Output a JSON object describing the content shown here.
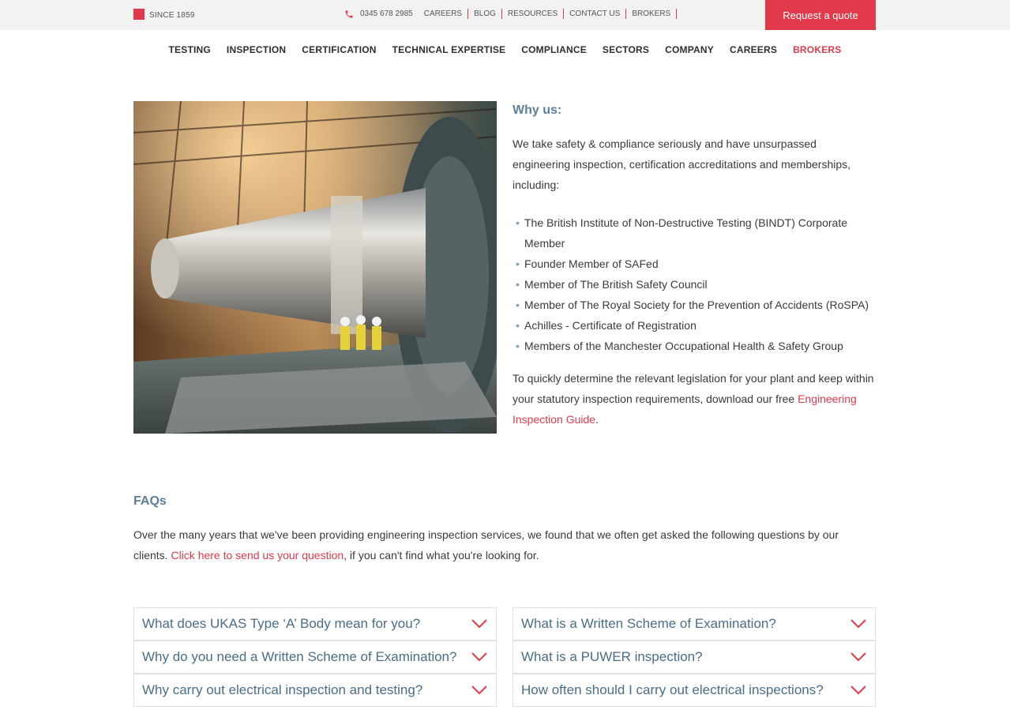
{
  "topbar": {
    "brand_since": "SINCE 1859",
    "phone": "0345 678 2985",
    "links": [
      "CAREERS",
      "BLOG",
      "RESOURCES",
      "CONTACT US",
      "BROKERS"
    ],
    "quote_button": "Request a quote",
    "accent_color": "#e23a4a"
  },
  "nav": {
    "items": [
      "TESTING",
      "INSPECTION",
      "CERTIFICATION",
      "TECHNICAL EXPERTISE",
      "COMPLIANCE",
      "SECTORS",
      "COMPANY",
      "CAREERS",
      "BROKERS"
    ],
    "active": "BROKERS"
  },
  "why": {
    "heading": "Why us:",
    "intro": "We take safety & compliance seriously and have unsurpassed engineering inspection, certification accreditations and memberships, including:",
    "bullets": [
      "The British Institute of Non-Destructive Testing (BINDT) Corporate Member",
      "Founder Member of SAFed",
      "Member of The British Safety Council",
      "Member of The Royal Society for the Prevention of Accidents (RoSPA)",
      "Achilles - Certificate of Registration",
      "Members of the Manchester Occupational Health & Safety Group"
    ],
    "outro": "To quickly determine the relevant legislation for your plant and keep within your statutory inspection requirements, download our free",
    "outro_link": "Engineering Inspection Guide",
    "outro_end": "."
  },
  "faqs": {
    "heading": "FAQs",
    "intro": "Over the many years that we've been providing engineering inspection services, we found that we often get asked the following questions by our clients.",
    "intro_link": "Click here to send us your question",
    "intro_end": ", if you can't find what you're looking for.",
    "questions": [
      "What does UKAS Type ‘A’ Body mean for you?",
      "What is a Written Scheme of Examination?",
      "Why do you need a Written Scheme of Examination?",
      "What is a PUWER inspection?",
      "Why carry out electrical inspection and testing?",
      "How often should I carry out electrical inspections?"
    ]
  }
}
